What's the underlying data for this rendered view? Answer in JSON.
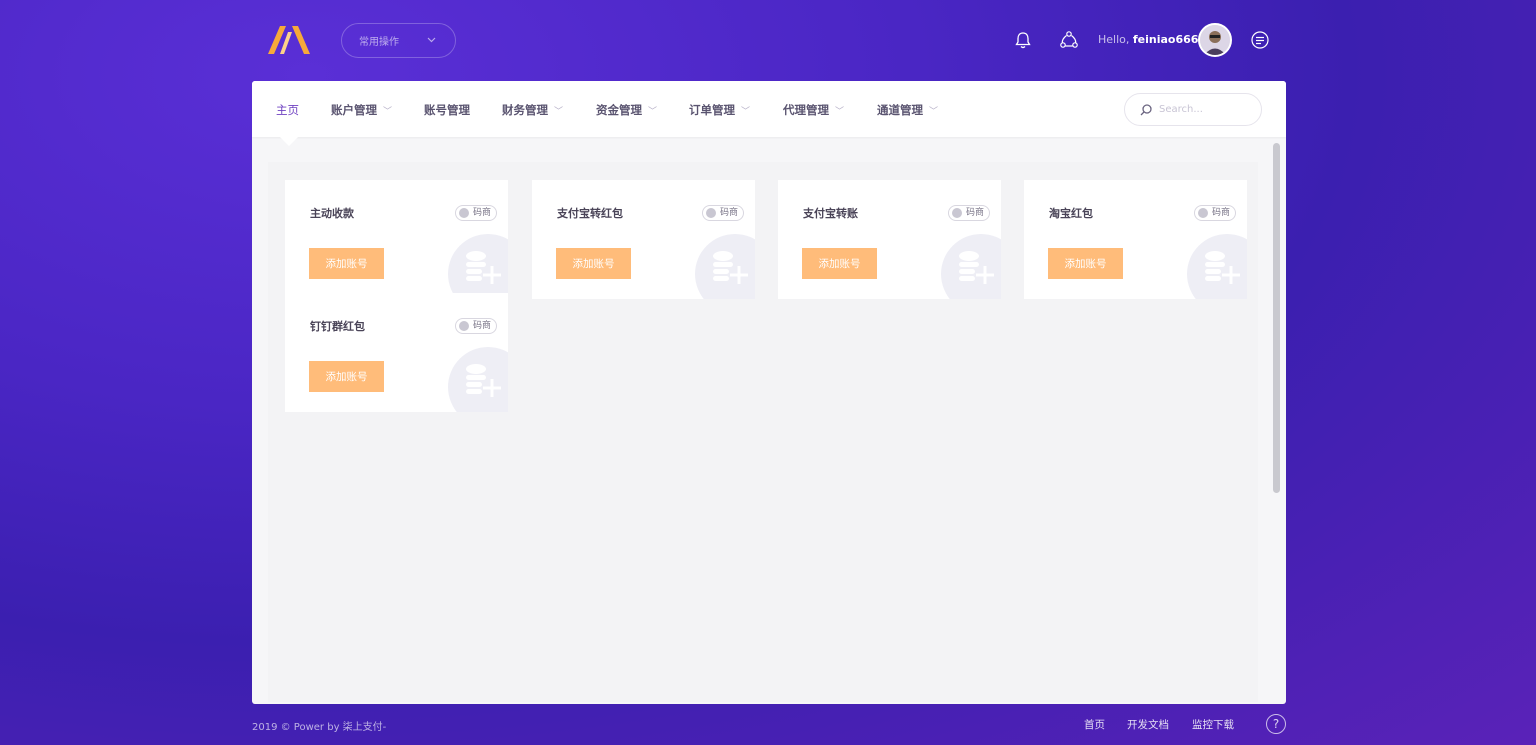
{
  "header": {
    "quick_ops_label": "常用操作",
    "hello_prefix": "Hello,",
    "username": "feiniao666"
  },
  "nav": {
    "items": [
      {
        "label": "主页",
        "dropdown": false,
        "active": true
      },
      {
        "label": "账户管理",
        "dropdown": true
      },
      {
        "label": "账号管理",
        "dropdown": false
      },
      {
        "label": "财务管理",
        "dropdown": true
      },
      {
        "label": "资金管理",
        "dropdown": true
      },
      {
        "label": "订单管理",
        "dropdown": true
      },
      {
        "label": "代理管理",
        "dropdown": true
      },
      {
        "label": "通道管理",
        "dropdown": true
      }
    ],
    "search_placeholder": "Search..."
  },
  "cards": [
    {
      "title": "主动收款",
      "badge": "码商",
      "button": "添加账号"
    },
    {
      "title": "支付宝转红包",
      "badge": "码商",
      "button": "添加账号"
    },
    {
      "title": "支付宝转账",
      "badge": "码商",
      "button": "添加账号"
    },
    {
      "title": "淘宝红包",
      "badge": "码商",
      "button": "添加账号"
    },
    {
      "title": "钉钉群红包",
      "badge": "码商",
      "button": "添加账号"
    }
  ],
  "footer": {
    "copyright": "2019 © Power by 柒上支付-",
    "links": [
      "首页",
      "开发文档",
      "监控下载"
    ]
  },
  "colors": {
    "accent": "#6f42c1",
    "button": "#ffbc7a",
    "background": "#4a26c4"
  }
}
